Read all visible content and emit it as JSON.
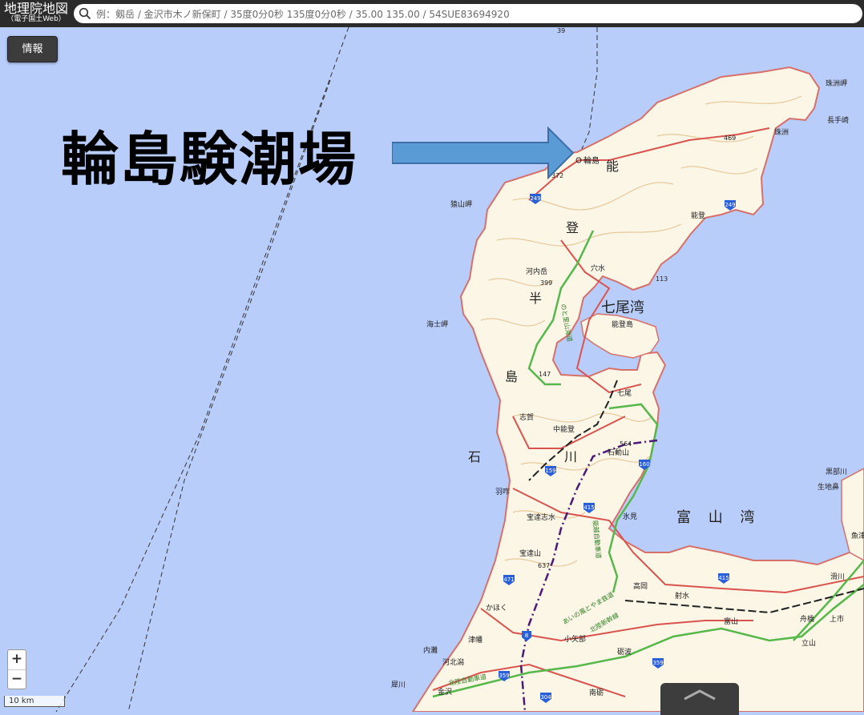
{
  "header": {
    "logo_main": "地理院地図",
    "logo_sub": "（電子国土Web）",
    "search_placeholder": "例：剱岳 / 金沢市木ノ新保町 / 35度0分0秒 135度0分0秒 / 35.00 135.00 / 54SUE83694920",
    "search_icon": "magnifier-icon"
  },
  "toolbar": {
    "info_label": "情報"
  },
  "annotation": {
    "title": "輪島験潮場",
    "color": "#5b9bd5"
  },
  "map": {
    "colors": {
      "sea": "#b9cdfb",
      "land": "#fbf6e6",
      "contour": "#e7c99c",
      "road_red": "#d9544f",
      "rail_green": "#56b84a"
    },
    "labels": {
      "wajima": "輪島",
      "suzu": "珠洲",
      "nagate": "長手崎",
      "suzumisaki": "珠洲岬",
      "noto_town": "能登",
      "sarusan": "猿山岬",
      "kochidake": "河内岳",
      "anamizu": "穴水",
      "nanaobay": "七尾湾",
      "notojima": "能登島",
      "nanao": "七尾",
      "kaishi": "海士岬",
      "shika": "志賀",
      "nakanoto": "中能登",
      "sekidozan": "石動山",
      "hakui": "羽咋",
      "himi": "氷見",
      "hodatsushimizu": "宝達志水",
      "hodatsuzan": "宝達山",
      "kahoku": "かほく",
      "tsubata": "津幡",
      "uchinada": "内灘",
      "kahokugata": "河北潟",
      "oyabe": "小矢部",
      "tonami": "砺波",
      "nanto": "南砺",
      "takaoka": "高岡",
      "imizu": "射水",
      "toyama": "富山",
      "namerikawa": "滑川",
      "kamiichi": "上市",
      "funahashi": "舟橋",
      "tateyama": "立山",
      "kanazawa": "金沢",
      "saigawa": "犀川",
      "kurobegawa": "黒部川",
      "ikuji": "生地鼻",
      "uozu": "魚津",
      "toyamabay": "富 山 湾",
      "peninsula": [
        "能",
        "登",
        "半",
        "島"
      ],
      "pref": [
        "石",
        "川"
      ],
      "noto_road": "能越自動車道",
      "noto_satoyama": "のと里山海道",
      "hokuriku_exp": "北陸自動車道",
      "hokuriku_line": "北陸新幹線",
      "ainokaze": "あいの風とやま鉄道",
      "rt_249a": "249",
      "rt_249b": "249",
      "rt_159": "159",
      "rt_160": "160",
      "rt_415a": "415",
      "rt_415b": "415",
      "rt_471": "471",
      "rt_359a": "359",
      "rt_359b": "359",
      "rt_304": "304",
      "rt_8": "8",
      "el_469": "469",
      "el_372": "372",
      "el_399": "399",
      "el_113": "113",
      "el_147": "147",
      "el_564": "564",
      "el_637": "637",
      "el_39": "39"
    }
  },
  "controls": {
    "zoom_in": "+",
    "zoom_out": "−",
    "scale_label": "10 km"
  }
}
